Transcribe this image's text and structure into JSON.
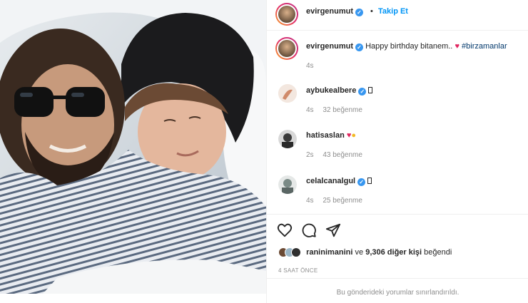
{
  "post": {
    "photo_alt": "Selfie photo",
    "author": "evirgenumut",
    "follow_label": "Takip Et",
    "separator": "•"
  },
  "caption": {
    "username": "evirgenumut",
    "text": "Happy birthday bitanem..",
    "hashtag": "#birzamanlar",
    "time": "4s"
  },
  "comments": [
    {
      "username": "aybukealbere",
      "time": "4s",
      "likes": "32 beğenme",
      "avatar_color": "#d8a890"
    },
    {
      "username": "hatisaslan",
      "time": "2s",
      "likes": "43 beğenme",
      "avatar_color": "#3a3a3a"
    },
    {
      "username": "celalcanalgul",
      "time": "4s",
      "likes": "25 beğenme",
      "avatar_color": "#7a8a86"
    }
  ],
  "likes": {
    "first_liker": "raninimanini",
    "connector": "ve",
    "count_text": "9,306 diğer kişi",
    "suffix": "beğendi"
  },
  "timeago": "4 SAAT ÖNCE",
  "restricted_notice": "Bu gönderideki yorumlar sınırlandırıldı.",
  "colors": {
    "accent": "#0095f6",
    "verified": "#3897f0",
    "heart": "#e0245e"
  }
}
